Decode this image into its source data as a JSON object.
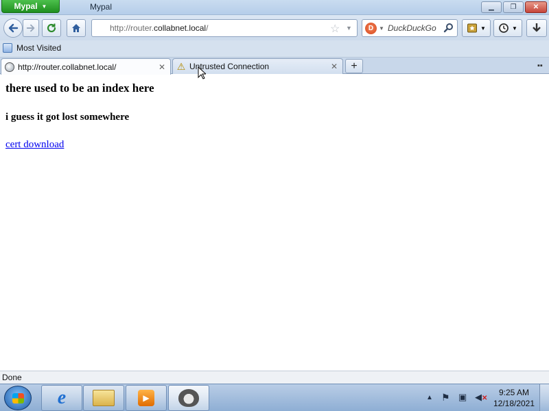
{
  "window": {
    "app_menu_label": "Mypal",
    "title": "Mypal"
  },
  "toolbar": {
    "url_prefix": "http://router.",
    "url_host": "collabnet.local",
    "url_suffix": "/",
    "search_placeholder": "DuckDuckGo"
  },
  "bookmarks": {
    "items": [
      {
        "label": "Most Visited",
        "icon": "globe-folder-icon"
      }
    ]
  },
  "tabs": [
    {
      "label": "http://router.collabnet.local/",
      "icon": "globe-icon",
      "active": true
    },
    {
      "label": "Untrusted Connection",
      "icon": "warning-icon",
      "active": false
    }
  ],
  "page": {
    "heading": "there used to be an index here",
    "subheading": "i guess it got lost somewhere",
    "link_text": "cert download"
  },
  "status": {
    "text": "Done"
  },
  "taskbar": {
    "pinned": [
      "internet-explorer-icon",
      "file-explorer-icon",
      "media-player-icon",
      "mypal-icon"
    ],
    "clock_time": "9:25 AM",
    "clock_date": "12/18/2021"
  },
  "colors": {
    "link": "#0000ee",
    "app_button": "#2a9a2a",
    "close_button": "#c6453a"
  }
}
